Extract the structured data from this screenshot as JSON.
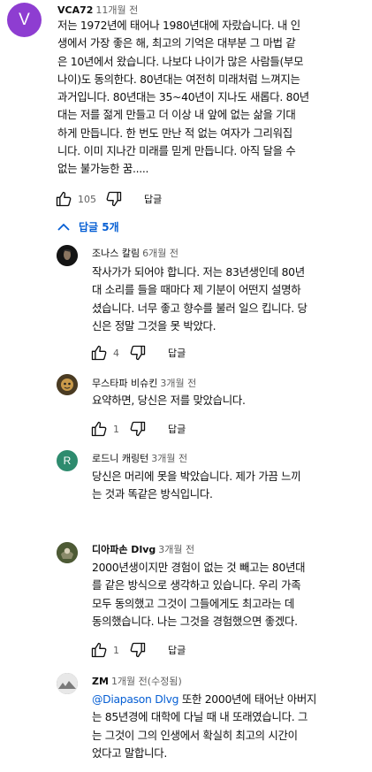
{
  "top_comment": {
    "avatar_letter": "V",
    "avatar_color": "#8e3dd1",
    "author": "VCA72",
    "time": "11개월 전",
    "text": "저는 1972년에 태어나 1980년대에 자랐습니다. 내 인\n생에서 가장 좋은 해, 최고의 기억은 대부분 그 마법 같\n은 10년에서 왔습니다. 나보다 나이가 많은 사람들(부모\n나이)도 동의한다. 80년대는 여전히 미래처럼 느껴지는\n과거입니다. 80년대는 35~40년이 지나도 새롭다. 80년\n대는 저를 젊게 만들고 더 이상 내 앞에 없는 삶을 기대\n하게 만듭니다. 한 번도 만난 적 없는 여자가 그리워집\n니다. 이미 지나간 미래를 믿게 만듭니다. 아직 달을 수\n없는 불가능한 꿈.....",
    "likes": "105",
    "reply_label": "답글"
  },
  "replies_toggle": "답글 5개",
  "replies": [
    {
      "author": "조나스 칼림",
      "time": "6개월 전",
      "text": "작사가가 되어야 합니다. 저는 83년생인데 80년\n대 소리를 들을 때마다 제 기분이 어떤지 설명하\n셨습니다. 너무 좋고 향수를 불러 일으 킵니다. 당\n신은 정말 그것을 못 박았다.",
      "likes": "4",
      "reply_label": "답글"
    },
    {
      "author": "무스타파 비슈킨",
      "time": "3개월 전",
      "text": "요약하면, 당신은 저를 맞았습니다.",
      "likes": "1",
      "reply_label": "답글"
    },
    {
      "avatar_letter": "R",
      "avatar_color": "#2e8b6e",
      "author": "로드니 캐링턴",
      "time": "3개월 전",
      "text": "당신은 머리에 못을 박았습니다. 제가 가끔 느끼\n는 것과 똑같은 방식입니다.",
      "likes": "",
      "reply_label": ""
    },
    {
      "author": "디아파손 Dlvg",
      "time": "3개월 전",
      "text": "2000년생이지만 경험이 없는 것 빼고는 80년대\n를 같은 방식으로 생각하고 있습니다. 우리 가족\n모두 동의했고 그것이 그들에게도 최고라는 데\n동의했습니다. 나는 그것을 경험했으면 좋겠다.",
      "likes": "1",
      "reply_label": "답글"
    },
    {
      "author": "ZM",
      "time": "1개월 전(수정됨)",
      "mention": "@Diapason Dlvg",
      "text": " 또한 2000년에 태어난 아버지\n는 85년경에 대학에 다닐 때 내 또래였습니다. 그\n는 그것이 그의 인생에서 확실히 최고의 시간이\n었다고 말합니다.",
      "likes": "",
      "reply_label": ""
    }
  ]
}
